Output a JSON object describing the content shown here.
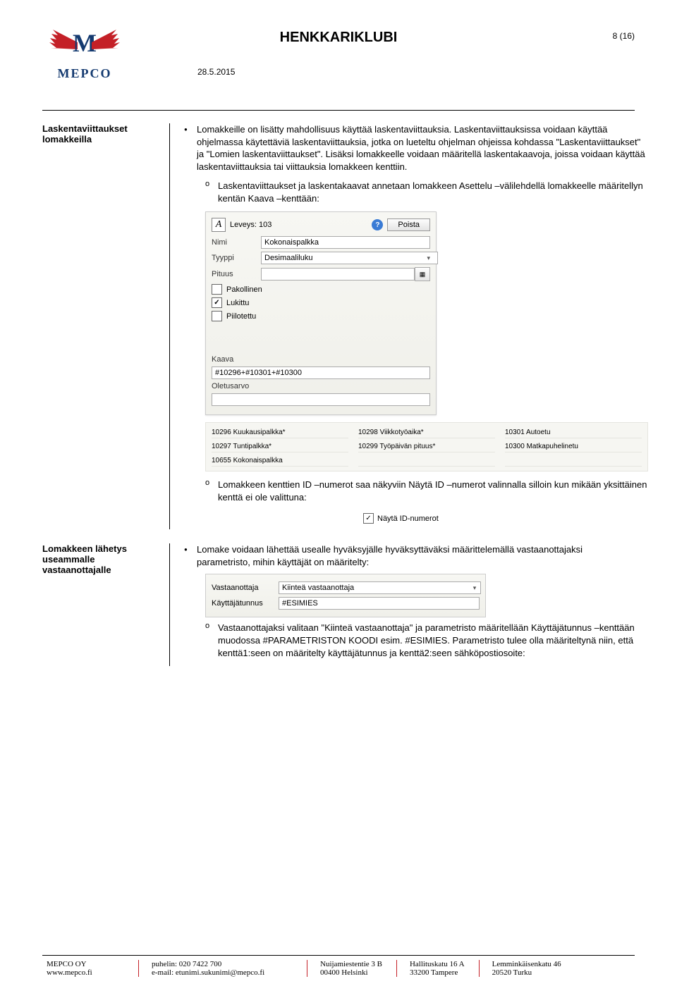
{
  "header": {
    "logo_letter": "M",
    "logo_text": "MEPCO",
    "title": "HENKKARIKLUBI",
    "date": "28.5.2015",
    "page": "8 (16)"
  },
  "section1": {
    "heading": "Laskentaviittaukset lomakkeilla",
    "bullet": "Lomakkeille on lisätty mahdollisuus käyttää laskentaviittauksia. Laskentaviittauksissa voidaan käyttää ohjelmassa käytettäviä laskentaviittauksia, jotka on lueteltu ohjelman ohjeissa kohdassa \"Laskentaviittaukset\" ja \"Lomien laskentaviittaukset\". Lisäksi lomakkeelle voidaan määritellä laskentakaavoja, joissa voidaan käyttää laskentaviittauksia tai viittauksia lomakkeen kenttiin.",
    "sub1": "Laskentaviittaukset ja laskentakaavat annetaan lomakkeen Asettelu –välilehdellä lomakkeelle määritellyn kentän Kaava –kenttään:"
  },
  "panel": {
    "leveys_label": "Leveys:",
    "leveys_value": "103",
    "poista": "Poista",
    "nimi_label": "Nimi",
    "nimi_value": "Kokonaispalkka",
    "tyyppi_label": "Tyyppi",
    "tyyppi_value": "Desimaaliluku",
    "pituus_label": "Pituus",
    "pituus_value": "",
    "cb_pakollinen": "Pakollinen",
    "cb_lukittu": "Lukittu",
    "cb_piilotettu": "Piilotettu",
    "kaava_label": "Kaava",
    "kaava_value": "#10296+#10301+#10300",
    "oletus_label": "Oletusarvo",
    "oletus_value": ""
  },
  "fieldlist": {
    "c1": "10296 Kuukausipalkka*",
    "c2": "10298 Viikkotyöaika*",
    "c3": "10301 Autoetu",
    "c4": "10297 Tuntipalkka*",
    "c5": "10299 Työpäivän pituus*",
    "c6": "10300 Matkapuhelinetu",
    "c7": "10655 Kokonaispalkka",
    "c8": "",
    "c9": ""
  },
  "section1b": {
    "sub2": "Lomakkeen kenttien ID –numerot saa näkyviin Näytä ID –numerot valinnalla silloin kun mikään yksittäinen kenttä ei ole valittuna:"
  },
  "show_id_label": "Näytä ID-numerot",
  "section2": {
    "heading": "Lomakkeen lähetys useammalle vastaanottajalle",
    "bullet": "Lomake voidaan lähettää usealle hyväksyjälle hyväksyttäväksi määrittelemällä vastaanottajaksi parametristo, mihin käyttäjät on määritelty:",
    "sub1": "Vastaanottajaksi valitaan \"Kiinteä vastaanottaja\" ja parametristo määritellään Käyttäjätunnus –kenttään muodossa #PARAMETRISTON KOODI esim. #ESIMIES. Parametristo tulee olla määriteltynä niin, että kenttä1:seen on määritelty käyttäjätunnus ja kenttä2:seen sähköpostiosoite:"
  },
  "recv": {
    "vast_label": "Vastaanottaja",
    "vast_value": "Kiinteä vastaanottaja",
    "kt_label": "Käyttäjätunnus",
    "kt_value": "#ESIMIES"
  },
  "footer": {
    "col1a": "MEPCO OY",
    "col1b": "www.mepco.fi",
    "col2a": "puhelin: 020 7422 700",
    "col2b": "e-mail: etunimi.sukunimi@mepco.fi",
    "col3a": "Nuijamiestentie 3 B",
    "col3b": "00400 Helsinki",
    "col4a": "Hallituskatu 16 A",
    "col4b": "33200 Tampere",
    "col5a": "Lemminkäisenkatu 46",
    "col5b": "20520 Turku"
  }
}
